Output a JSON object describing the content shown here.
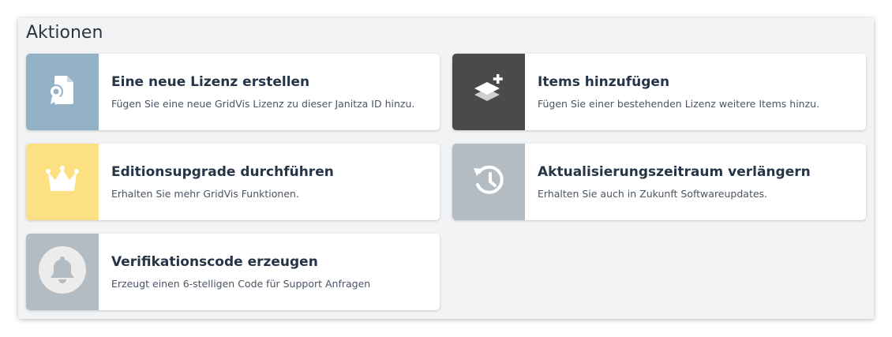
{
  "section": {
    "title": "Aktionen"
  },
  "actions": [
    {
      "title": "Eine neue Lizenz erstellen",
      "description": "Fügen Sie eine neue GridVis Lizenz zu dieser Janitza ID hinzu.",
      "icon": "license-certificate-icon",
      "tile_color": "#94b2c7"
    },
    {
      "title": "Items hinzufügen",
      "description": "Fügen Sie einer bestehenden Lizenz weitere Items hinzu.",
      "icon": "layers-plus-icon",
      "tile_color": "#4a4a4a"
    },
    {
      "title": "Editionsupgrade durchführen",
      "description": "Erhalten Sie mehr GridVis Funktionen.",
      "icon": "crown-icon",
      "tile_color": "#fde081"
    },
    {
      "title": "Aktualisierungszeitraum verlängern",
      "description": "Erhalten Sie auch in Zukunft Softwareupdates.",
      "icon": "history-icon",
      "tile_color": "#b4bcc3"
    },
    {
      "title": "Verifikationscode erzeugen",
      "description": "Erzeugt einen 6-stelligen Code für Support Anfragen",
      "icon": "bell-icon",
      "tile_color": "#b4bcc3"
    }
  ]
}
